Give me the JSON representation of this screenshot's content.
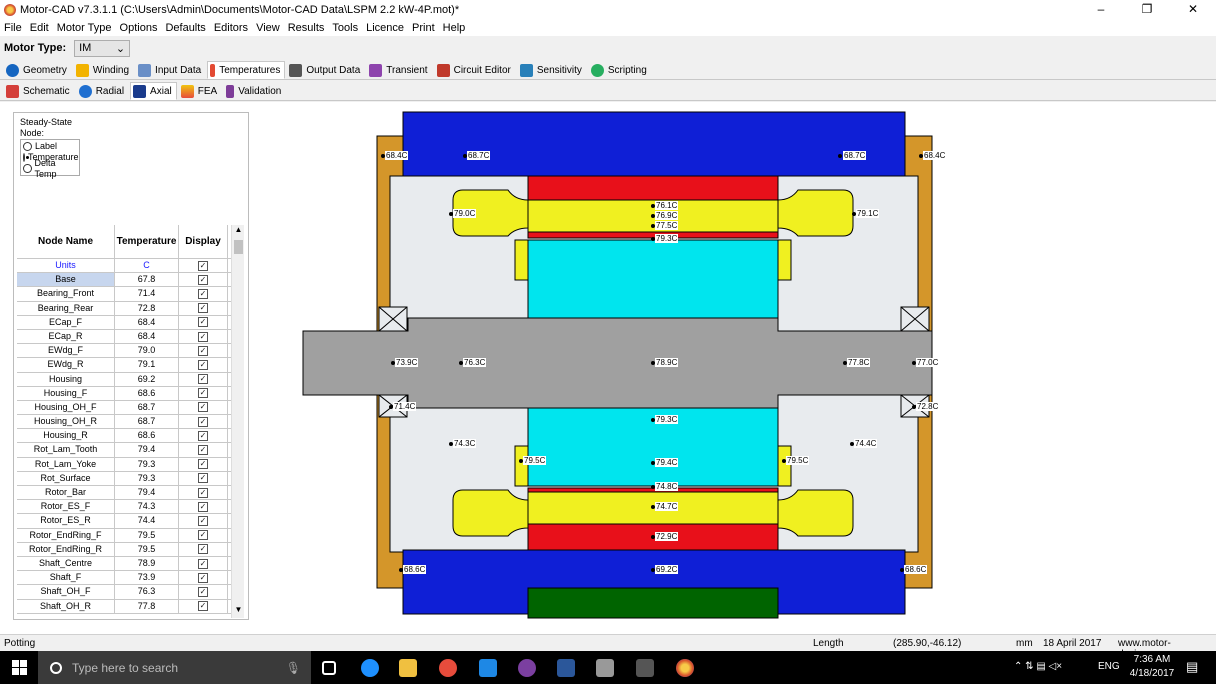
{
  "window": {
    "title": "Motor-CAD v7.3.1.1 (C:\\Users\\Admin\\Documents\\Motor-CAD Data\\LSPM 2.2 kW-4P.mot)*",
    "controls": [
      "–",
      "❐",
      "✕"
    ]
  },
  "menu": [
    "File",
    "Edit",
    "Motor Type",
    "Options",
    "Defaults",
    "Editors",
    "View",
    "Results",
    "Tools",
    "Licence",
    "Print",
    "Help"
  ],
  "motor_type": {
    "label": "Motor Type:",
    "value": "IM"
  },
  "main_tabs": [
    {
      "label": "Geometry",
      "color": "#1565c0"
    },
    {
      "label": "Winding",
      "color": "#f2b300"
    },
    {
      "label": "Input Data",
      "color": "#6a8fc7"
    },
    {
      "label": "Temperatures",
      "color": "#e34a33",
      "active": true
    },
    {
      "label": "Output Data",
      "color": "#555555"
    },
    {
      "label": "Transient",
      "color": "#8e44ad"
    },
    {
      "label": "Circuit Editor",
      "color": "#c0392b"
    },
    {
      "label": "Sensitivity",
      "color": "#2980b9"
    },
    {
      "label": "Scripting",
      "color": "#27ae60"
    }
  ],
  "sub_tabs": [
    {
      "label": "Schematic",
      "color": "#d43f3a"
    },
    {
      "label": "Radial",
      "color": "#1f6fd0"
    },
    {
      "label": "Axial",
      "color": "#1a3b8c",
      "active": true
    },
    {
      "label": "FEA",
      "color": "#f39c12"
    },
    {
      "label": "Validation",
      "color": "#7d3c98"
    }
  ],
  "options": {
    "title": "Steady-State",
    "group": "Node:",
    "radios": [
      {
        "label": "Label",
        "selected": false
      },
      {
        "label": "Temperature",
        "selected": true
      },
      {
        "label": "Delta Temp",
        "selected": false
      }
    ]
  },
  "table": {
    "headers": [
      "Node Name",
      "Temperature",
      "Display"
    ],
    "units": [
      "Units",
      "C"
    ],
    "rows": [
      [
        "Base",
        "67.8"
      ],
      [
        "Bearing_Front",
        "71.4"
      ],
      [
        "Bearing_Rear",
        "72.8"
      ],
      [
        "ECap_F",
        "68.4"
      ],
      [
        "ECap_R",
        "68.4"
      ],
      [
        "EWdg_F",
        "79.0"
      ],
      [
        "EWdg_R",
        "79.1"
      ],
      [
        "Housing",
        "69.2"
      ],
      [
        "Housing_F",
        "68.6"
      ],
      [
        "Housing_OH_F",
        "68.7"
      ],
      [
        "Housing_OH_R",
        "68.7"
      ],
      [
        "Housing_R",
        "68.6"
      ],
      [
        "Rot_Lam_Tooth",
        "79.4"
      ],
      [
        "Rot_Lam_Yoke",
        "79.3"
      ],
      [
        "Rot_Surface",
        "79.3"
      ],
      [
        "Rotor_Bar",
        "79.4"
      ],
      [
        "Rotor_ES_F",
        "74.3"
      ],
      [
        "Rotor_ES_R",
        "74.4"
      ],
      [
        "Rotor_EndRing_F",
        "79.5"
      ],
      [
        "Rotor_EndRing_R",
        "79.5"
      ],
      [
        "Shaft_Centre",
        "78.9"
      ],
      [
        "Shaft_F",
        "73.9"
      ],
      [
        "Shaft_OH_F",
        "76.3"
      ],
      [
        "Shaft_OH_R",
        "77.8"
      ]
    ]
  },
  "temps": {
    "t684l": "68.4C",
    "t687l": "68.7C",
    "t687r": "68.7C",
    "t684r": "68.4C",
    "t790": "79.0C",
    "t791": "79.1C",
    "t761": "76.1C",
    "t769": "76.9C",
    "t775": "77.5C",
    "t793a": "79.3C",
    "t739": "73.9C",
    "t763": "76.3C",
    "t789": "78.9C",
    "t778": "77.8C",
    "t770": "77.0C",
    "t714": "71.4C",
    "t728": "72.8C",
    "t793b": "79.3C",
    "t743": "74.3C",
    "t744": "74.4C",
    "t795l": "79.5C",
    "t794": "79.4C",
    "t795r": "79.5C",
    "t748": "74.8C",
    "t747": "74.7C",
    "t729": "72.9C",
    "t686l": "68.6C",
    "t692": "69.2C",
    "t686r": "68.6C"
  },
  "status": {
    "mode": "Potting",
    "length_label": "Length",
    "coords": "(285.90,-46.12)",
    "unit": "mm",
    "date": "18 April 2017",
    "site": "www.motor-design.com"
  },
  "taskbar": {
    "search": "Type here to search",
    "time": "7:36 AM",
    "date": "4/18/2017",
    "lang": "ENG"
  }
}
